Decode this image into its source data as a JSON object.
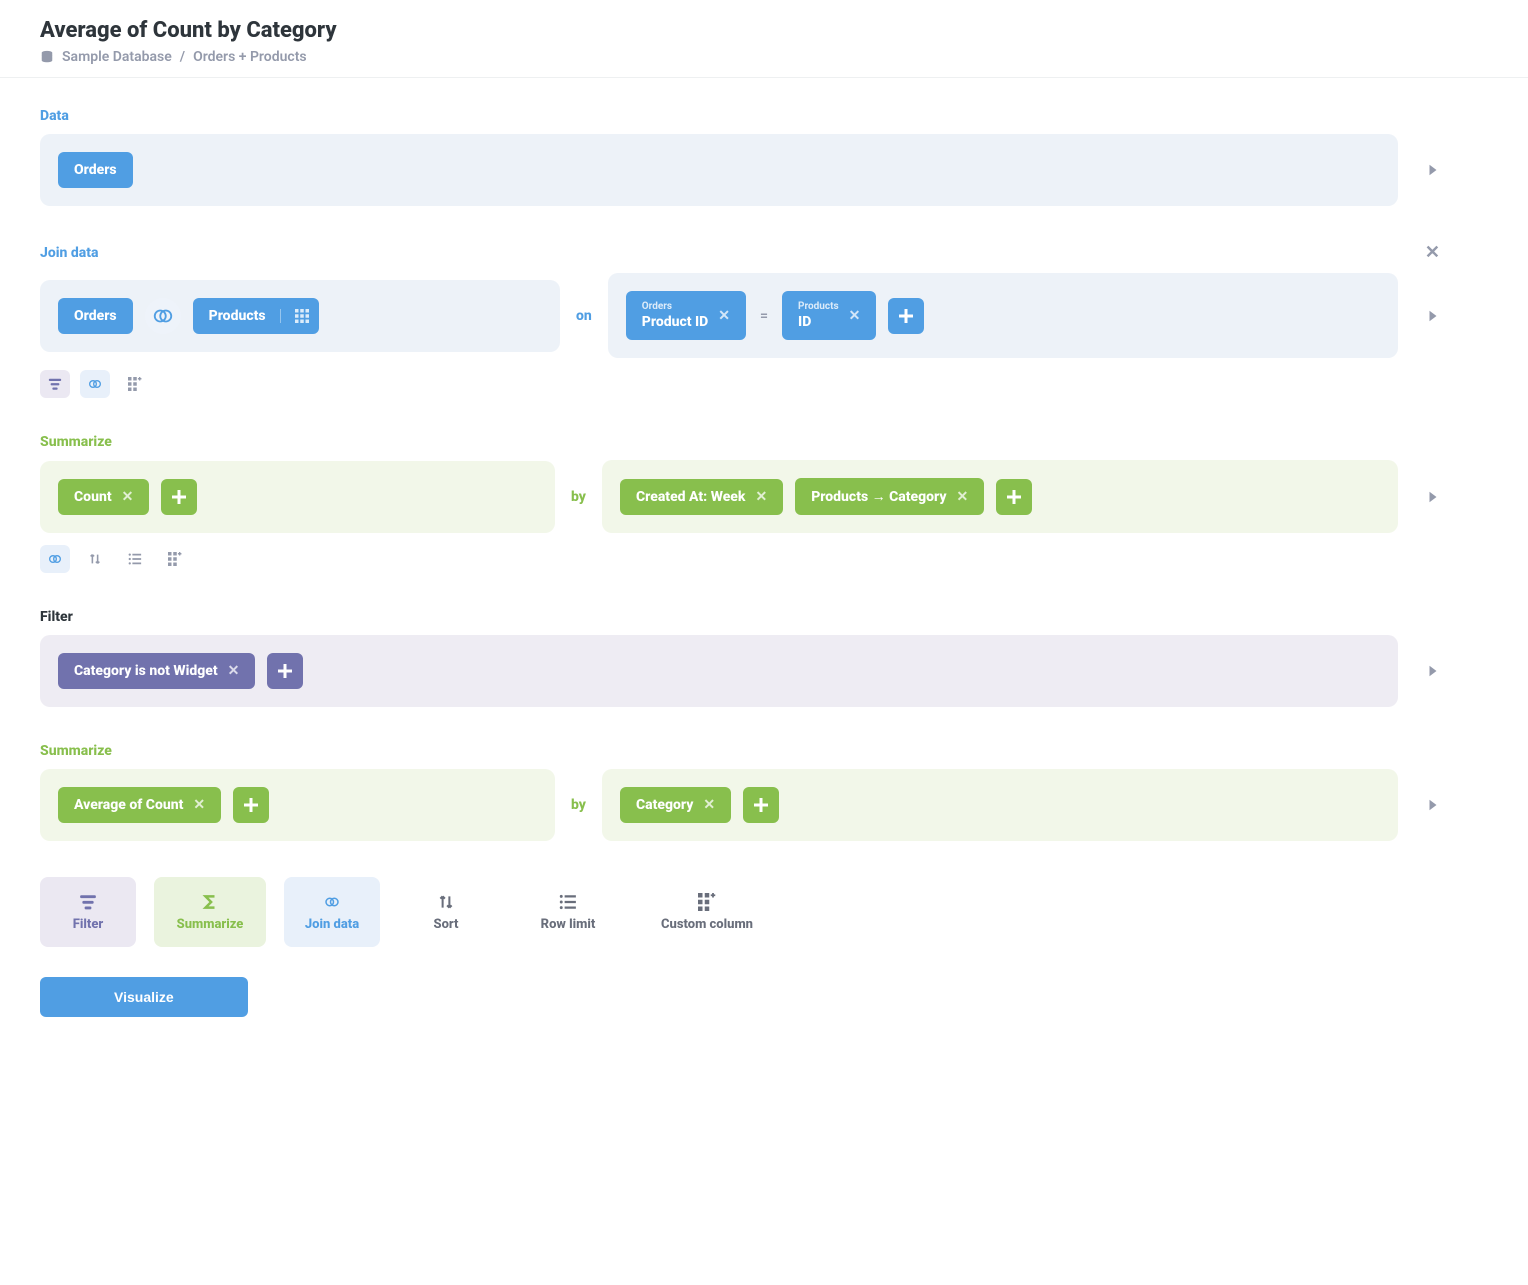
{
  "header": {
    "title": "Average of Count by Category",
    "breadcrumb_db": "Sample Database",
    "breadcrumb_sep": "/",
    "breadcrumb_tables": "Orders + Products"
  },
  "sections": {
    "data": {
      "label": "Data",
      "source": "Orders"
    },
    "join": {
      "label": "Join data",
      "left_table": "Orders",
      "right_table": "Products",
      "connector": "on",
      "left_col_table": "Orders",
      "left_col_field": "Product ID",
      "equals": "=",
      "right_col_table": "Products",
      "right_col_field": "ID"
    },
    "summarize1": {
      "label": "Summarize",
      "agg": "Count",
      "connector": "by",
      "group1": "Created At: Week",
      "group2": "Products → Category"
    },
    "filter": {
      "label": "Filter",
      "condition": "Category is not Widget"
    },
    "summarize2": {
      "label": "Summarize",
      "agg": "Average of Count",
      "connector": "by",
      "group1": "Category"
    }
  },
  "actions": {
    "filter": "Filter",
    "summarize": "Summarize",
    "join": "Join data",
    "sort": "Sort",
    "rowlimit": "Row limit",
    "custom": "Custom column"
  },
  "visualize": "Visualize"
}
